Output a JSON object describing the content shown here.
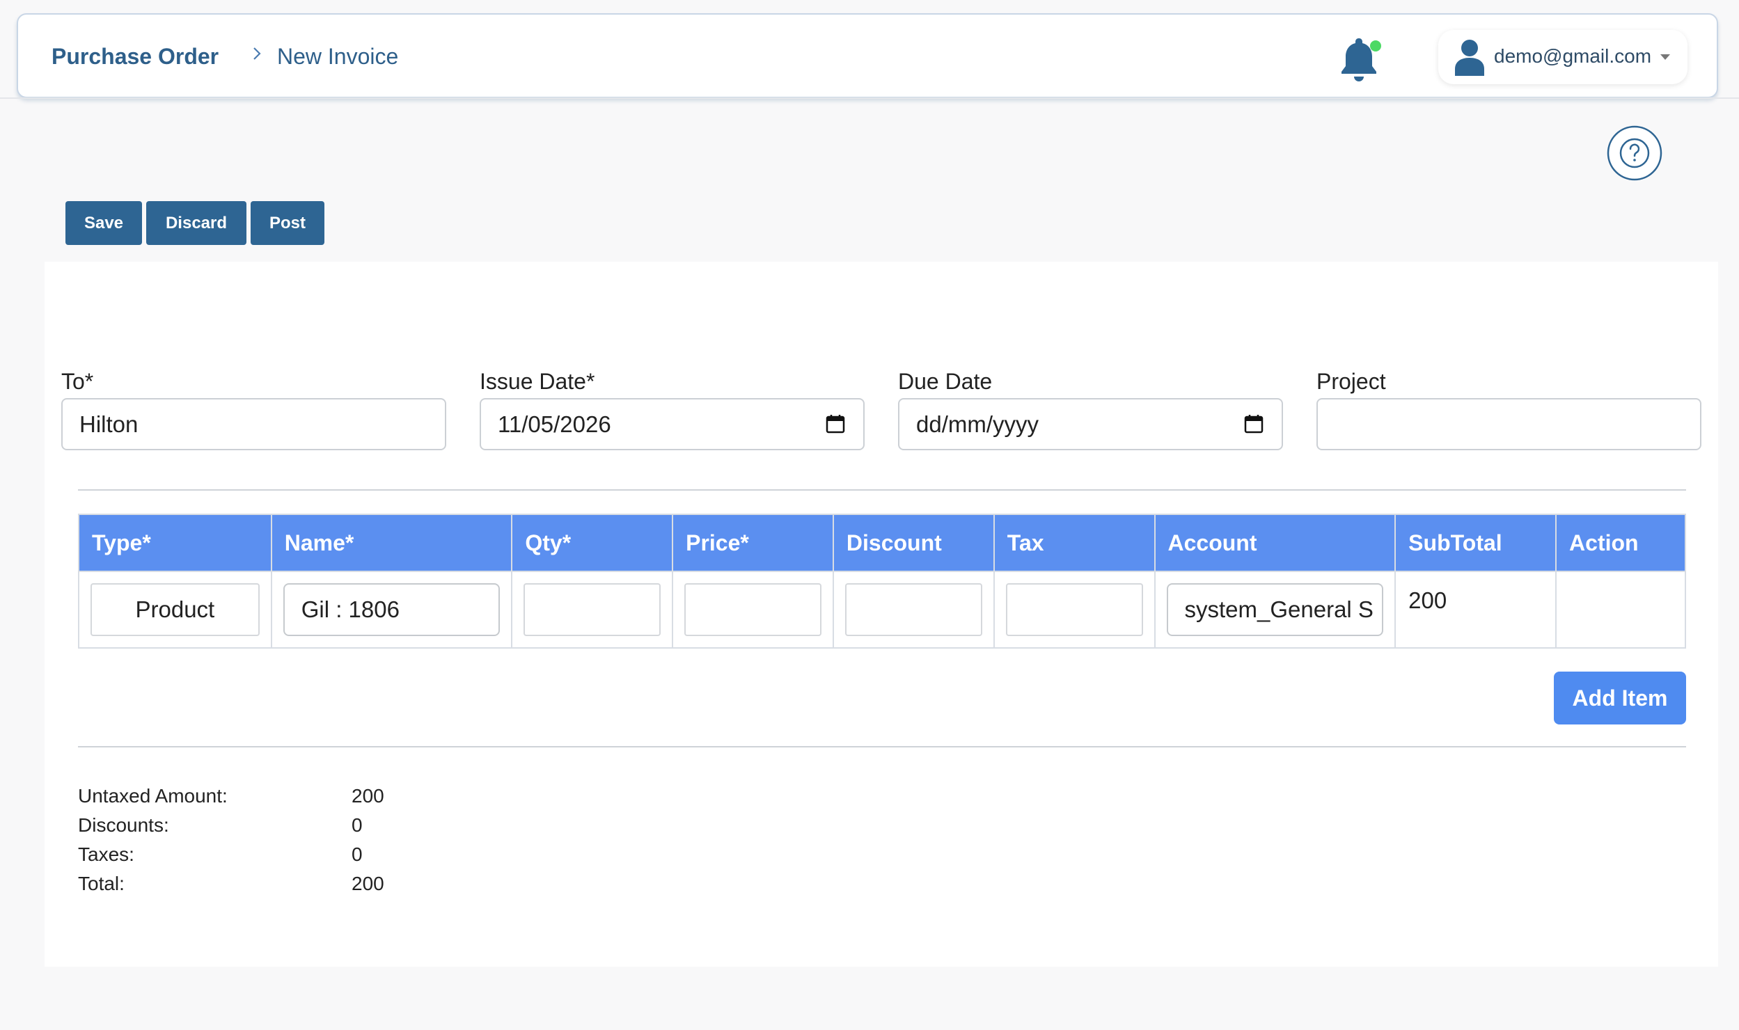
{
  "header": {
    "breadcrumb_root": "Purchase Order",
    "breadcrumb_current": "New Invoice",
    "user_email": "demo@gmail.com"
  },
  "toolbar": {
    "save_label": "Save",
    "discard_label": "Discard",
    "post_label": "Post"
  },
  "form": {
    "to_label": "To*",
    "to_value": "Hilton",
    "issue_date_label": "Issue Date*",
    "issue_date_value": "11/05/2026",
    "due_date_label": "Due Date",
    "due_date_placeholder": "dd/mm/yyyy",
    "project_label": "Project",
    "project_value": ""
  },
  "table": {
    "headers": [
      "Type*",
      "Name*",
      "Qty*",
      "Price*",
      "Discount",
      "Tax",
      "Account",
      "SubTotal",
      "Action"
    ],
    "rows": [
      {
        "type": "Product",
        "name": "Gil : 1806",
        "qty": "",
        "price": "",
        "discount": "",
        "tax": "",
        "account": "system_General S",
        "subtotal": "200",
        "action": ""
      }
    ]
  },
  "add_item_label": "Add Item",
  "totals": [
    {
      "label": "Untaxed Amount:",
      "value": "200"
    },
    {
      "label": "Discounts:",
      "value": "0"
    },
    {
      "label": "Taxes:",
      "value": "0"
    },
    {
      "label": "Total:",
      "value": "200"
    }
  ],
  "colors": {
    "primary_dark": "#2e6593",
    "table_header": "#5b8ff0",
    "add_button": "#4f8bf0",
    "notification_dot": "#4cd964"
  },
  "icons": [
    "chevron-right-icon",
    "bell-icon",
    "user-icon",
    "caret-down-icon",
    "help-icon",
    "calendar-icon"
  ]
}
